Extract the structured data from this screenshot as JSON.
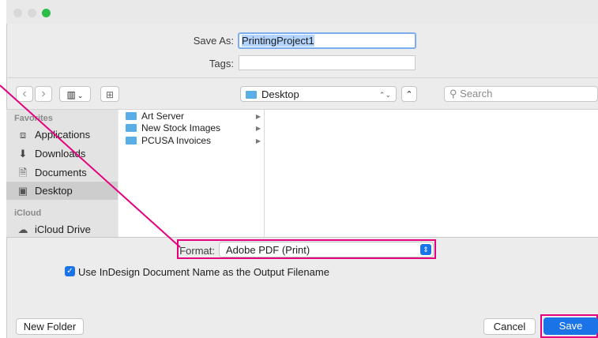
{
  "save_as": {
    "label": "Save As:",
    "value": "PrintingProject1"
  },
  "tags": {
    "label": "Tags:",
    "value": ""
  },
  "toolbar": {
    "back": "‹",
    "forward": "›",
    "view_glyph": "▥",
    "view_caret": "⌄",
    "new_folder_glyph": "⊞",
    "location": "Desktop",
    "location_caret": "⌃⌄",
    "expand": "⌃",
    "search_placeholder": "Search"
  },
  "sidebar": {
    "favorites_header": "Favorites",
    "favorites": [
      {
        "label": "Applications",
        "icon": "applications-icon"
      },
      {
        "label": "Downloads",
        "icon": "downloads-icon"
      },
      {
        "label": "Documents",
        "icon": "documents-icon"
      },
      {
        "label": "Desktop",
        "icon": "desktop-icon"
      }
    ],
    "icloud_header": "iCloud",
    "icloud": [
      {
        "label": "iCloud Drive",
        "icon": "cloud-icon"
      }
    ]
  },
  "files": [
    {
      "name": "Art Server"
    },
    {
      "name": "New Stock Images"
    },
    {
      "name": "PCUSA Invoices"
    }
  ],
  "format": {
    "label": "Format:",
    "value": "Adobe PDF (Print)"
  },
  "option": {
    "label": "Use InDesign Document Name as the Output Filename",
    "checked": true
  },
  "footer": {
    "new_folder": "New Folder",
    "cancel": "Cancel",
    "save": "Save"
  },
  "colors": {
    "accent": "#1b73e8",
    "highlight": "#e5007e",
    "folder": "#5aaee8"
  }
}
